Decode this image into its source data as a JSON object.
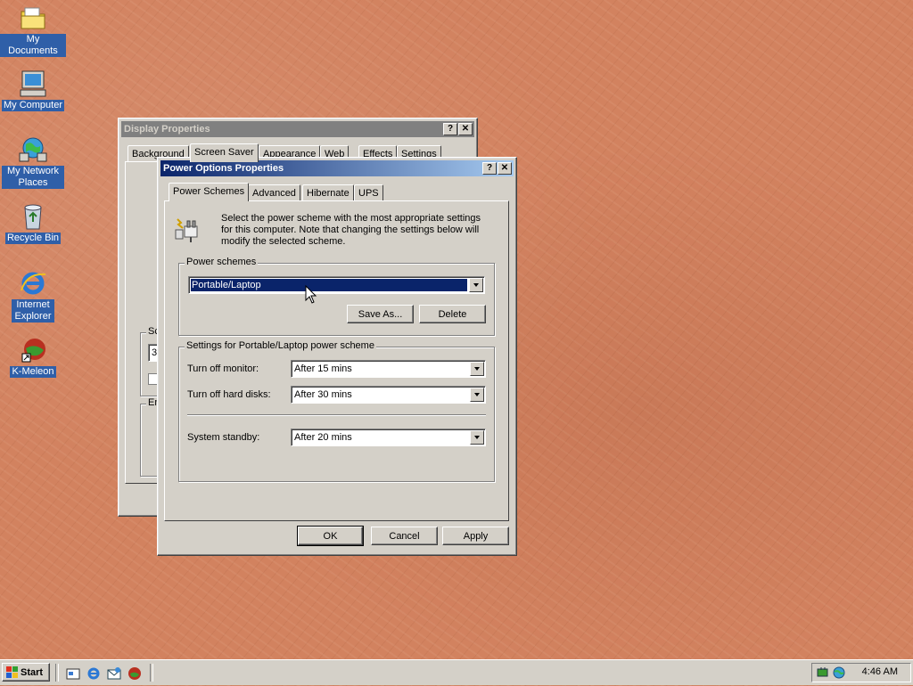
{
  "desktop": {
    "icons": [
      {
        "label": "My Documents",
        "icon": "folder-icon"
      },
      {
        "label": "My Computer",
        "icon": "computer-icon"
      },
      {
        "label": "My Network Places",
        "icon": "network-icon"
      },
      {
        "label": "Recycle Bin",
        "icon": "recycle-bin-icon"
      },
      {
        "label": "Internet Explorer",
        "icon": "internet-explorer-icon"
      },
      {
        "label": "K-Meleon",
        "icon": "k-meleon-icon"
      }
    ]
  },
  "display_properties": {
    "title": "Display Properties",
    "help_button": "?",
    "close_button": "✕",
    "tabs": [
      "Background",
      "Screen Saver",
      "Appearance",
      "Web",
      "Effects",
      "Settings"
    ],
    "partial_group_1": "Sc",
    "partial_value": "3",
    "partial_group_2": "En"
  },
  "power_options": {
    "title": "Power Options Properties",
    "help_button": "?",
    "close_button": "✕",
    "tabs": [
      "Power Schemes",
      "Advanced",
      "Hibernate",
      "UPS"
    ],
    "description": "Select the power scheme with the most appropriate settings for this computer. Note that changing the settings below will modify the selected scheme.",
    "schemes_group": "Power schemes",
    "scheme_value": "Portable/Laptop",
    "save_as": "Save As...",
    "delete": "Delete",
    "settings_group": "Settings for Portable/Laptop power scheme",
    "monitor_label": "Turn off monitor:",
    "monitor_value": "After 15 mins",
    "disks_label": "Turn off hard disks:",
    "disks_value": "After 30 mins",
    "standby_label": "System standby:",
    "standby_value": "After 20 mins",
    "ok": "OK",
    "cancel": "Cancel",
    "apply": "Apply"
  },
  "taskbar": {
    "start": "Start",
    "quick_launch": [
      "show-desktop-icon",
      "internet-explorer-icon",
      "outlook-express-icon",
      "k-meleon-icon"
    ],
    "clock": "4:46 AM"
  },
  "colors": {
    "desktop": "#d2825f",
    "title_active": "#0a246a",
    "title_gradient": "#a6caf0",
    "selection": "#0a246a",
    "face": "#d4d0c8"
  }
}
